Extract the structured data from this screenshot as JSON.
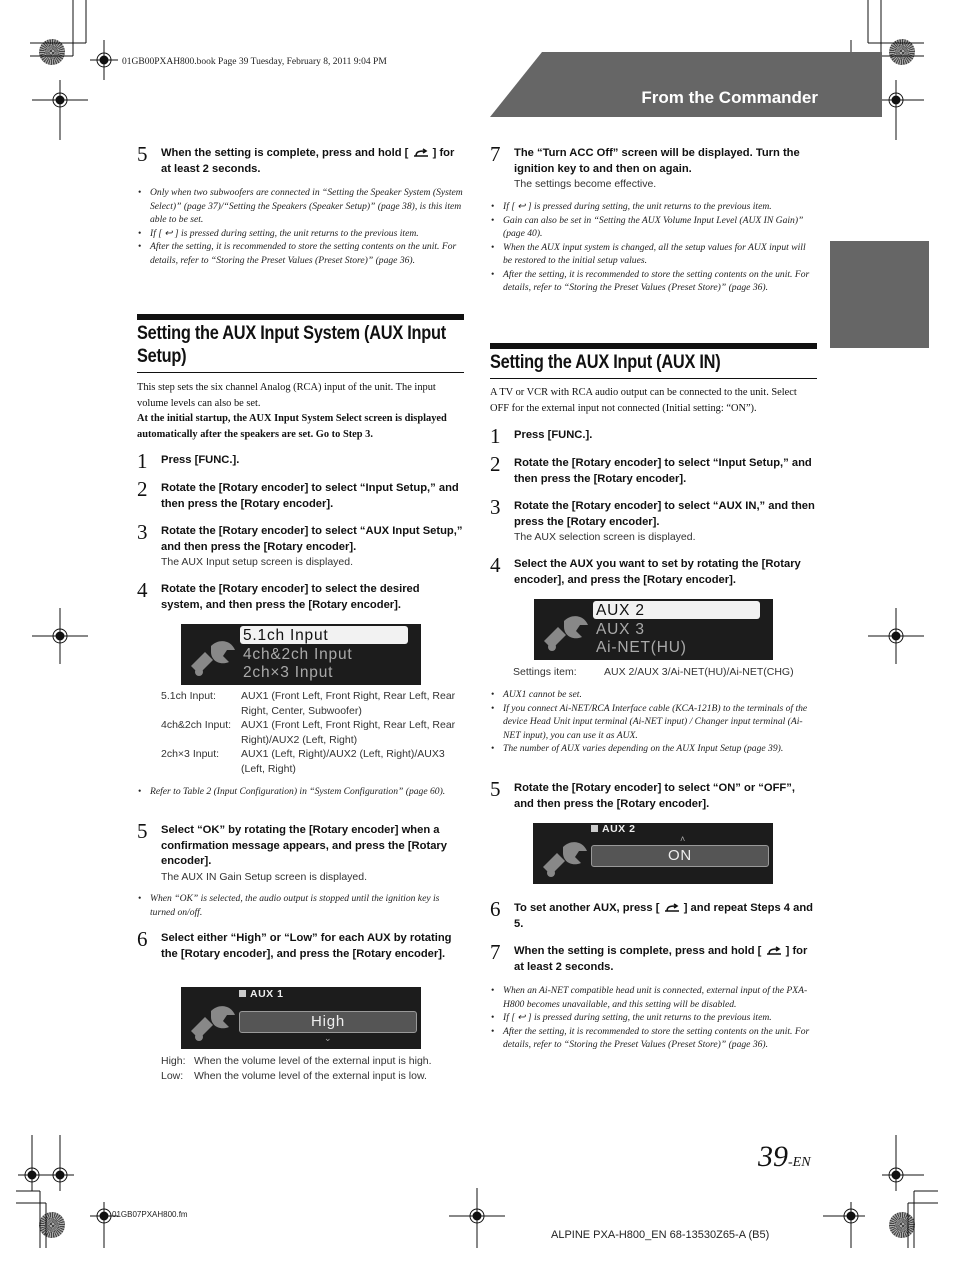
{
  "header": {
    "book_line": "01GB00PXAH800.book  Page 39  Tuesday, February 8, 2011  9:04 PM",
    "section_banner": "From the Commander",
    "colors": {
      "banner": "#666666",
      "side_tab": "#666666"
    }
  },
  "left": {
    "step5_top": {
      "num": "5",
      "text_a": "When the setting is complete, press and hold [",
      "text_b": "] for at least 2 seconds.",
      "icon": "back-icon"
    },
    "notes_top": [
      "Only when two subwoofers are connected in “Setting the Speaker System (System Select)” (page 37)/“Setting the Speakers (Speaker Setup)” (page 38), is this item able to be set.",
      "If [ ↩ ] is pressed during setting, the unit returns to the previous item.",
      "After the setting, it is recommended to store the setting contents on the unit. For details, refer to “Storing the Preset Values (Preset Store)” (page 36)."
    ],
    "section_title": "Setting the AUX Input System (AUX Input Setup)",
    "section_title_line1": "Setting the AUX Input System (AUX Input",
    "section_title_line2": "Setup)",
    "intro": "This step sets the six channel Analog (RCA) input of the unit. The input volume levels can also be set.",
    "intro_bold": "At the initial startup, the AUX Input System Select screen is displayed automatically after the speakers are set. Go to Step 3.",
    "steps": [
      {
        "num": "1",
        "text": "Press [FUNC.]."
      },
      {
        "num": "2",
        "text": "Rotate the [Rotary encoder] to select “Input Setup,” and then press the [Rotary encoder]."
      },
      {
        "num": "3",
        "text": "Rotate the [Rotary encoder] to select “AUX Input Setup,” and then press the [Rotary encoder].",
        "sub": "The AUX Input setup screen is displayed."
      },
      {
        "num": "4",
        "text": "Rotate the [Rotary encoder] to select the desired system, and then press the [Rotary encoder]."
      }
    ],
    "screen1": {
      "options": [
        "5.1ch Input",
        "4ch&2ch Input",
        "2ch×3 Input"
      ],
      "selected": "5.1ch Input"
    },
    "definitions": [
      {
        "key": "5.1ch Input:",
        "value": "AUX1 (Front Left, Front Right, Rear Left, Rear Right, Center, Subwoofer)"
      },
      {
        "key": "4ch&2ch Input:",
        "value": "AUX1 (Front Left, Front Right, Rear Left, Rear Right)/AUX2 (Left, Right)"
      },
      {
        "key": "2ch×3 Input:",
        "value": "AUX1 (Left, Right)/AUX2 (Left, Right)/AUX3 (Left, Right)"
      }
    ],
    "note_table": "Refer to Table 2 (Input Configuration) in “System Configuration” (page 60).",
    "step5": {
      "num": "5",
      "text": "Select “OK” by rotating the [Rotary encoder] when a confirmation message appears, and press the [Rotary encoder].",
      "sub": "The AUX IN Gain Setup screen is displayed."
    },
    "note_ok": "When “OK” is selected, the audio output is stopped until the ignition key is turned on/off.",
    "step6": {
      "num": "6",
      "text": "Select either “High” or “Low” for each AUX by rotating the [Rotary encoder], and press the [Rotary encoder]."
    },
    "screen2": {
      "label": "AUX 1",
      "value": "High"
    },
    "gain_defs": [
      {
        "key": "High:",
        "value": "When the volume level of the external input is high."
      },
      {
        "key": "Low:",
        "value": "When the volume level of the external input is low."
      }
    ]
  },
  "right": {
    "step7_top": {
      "num": "7",
      "text": "The “Turn ACC Off” screen will be displayed. Turn the ignition key to and then on again.",
      "sub": "The settings become effective."
    },
    "notes_top": [
      "If [ ↩ ] is pressed during setting, the unit returns to the previous item.",
      "Gain can also be set in “Setting the AUX Volume Input Level (AUX IN Gain)” (page 40).",
      "When the AUX input system is changed, all the setup values for AUX input will be restored to the initial setup values.",
      "After the setting, it is recommended to store the setting contents on the unit. For details, refer to “Storing the Preset Values (Preset Store)” (page 36)."
    ],
    "section_title": "Setting the AUX Input (AUX IN)",
    "intro": "A TV or VCR with RCA audio output can be connected to the unit. Select OFF for the external input not connected (Initial setting: “ON”).",
    "steps": [
      {
        "num": "1",
        "text": "Press [FUNC.]."
      },
      {
        "num": "2",
        "text": "Rotate the [Rotary encoder] to select “Input Setup,” and then press the [Rotary encoder]."
      },
      {
        "num": "3",
        "text": "Rotate the [Rotary encoder] to select “AUX IN,” and then press the [Rotary encoder].",
        "sub": "The AUX selection screen is displayed."
      },
      {
        "num": "4",
        "text": "Select the AUX you want to set by rotating the [Rotary encoder], and press the [Rotary encoder]."
      }
    ],
    "screen3": {
      "options": [
        "AUX 2",
        "AUX 3",
        "Ai-NET(HU)"
      ],
      "selected": "AUX 2"
    },
    "settings_item": {
      "key": "Settings item:",
      "value": "AUX 2/AUX 3/Ai-NET(HU)/Ai-NET(CHG)"
    },
    "notes_aux": [
      "AUX1 cannot be set.",
      "If you connect Ai-NET/RCA Interface cable (KCA-121B) to the terminals of the device Head Unit input terminal (Ai-NET input) / Changer input terminal (Ai-NET input), you can use it as AUX.",
      "The number of AUX varies depending on the AUX Input Setup (page 39)."
    ],
    "step5": {
      "num": "5",
      "text": "Rotate the [Rotary encoder] to select “ON” or “OFF”, and then press the [Rotary encoder]."
    },
    "screen4": {
      "label": "AUX 2",
      "value": "ON"
    },
    "step6": {
      "num": "6",
      "text_a": "To set another AUX, press [",
      "text_b": "] and repeat Steps 4 and 5."
    },
    "step7": {
      "num": "7",
      "text_a": "When the setting is complete, press and hold [",
      "text_b": "] for at least 2 seconds."
    },
    "notes_bottom": [
      "When an Ai-NET compatible head unit is connected, external input of the PXA-H800 becomes unavailable, and this setting will be disabled.",
      "If [ ↩ ] is pressed during setting, the unit returns to the previous item.",
      "After the setting, it is recommended to store the setting contents on the unit. For details, refer to “Storing the Preset Values (Preset Store)” (page 36)."
    ]
  },
  "footer": {
    "page_number": "39",
    "page_suffix": "-EN",
    "file_name": "01GB07PXAH800.fm",
    "product_code": "ALPINE PXA-H800_EN 68-13530Z65-A (B5)"
  }
}
